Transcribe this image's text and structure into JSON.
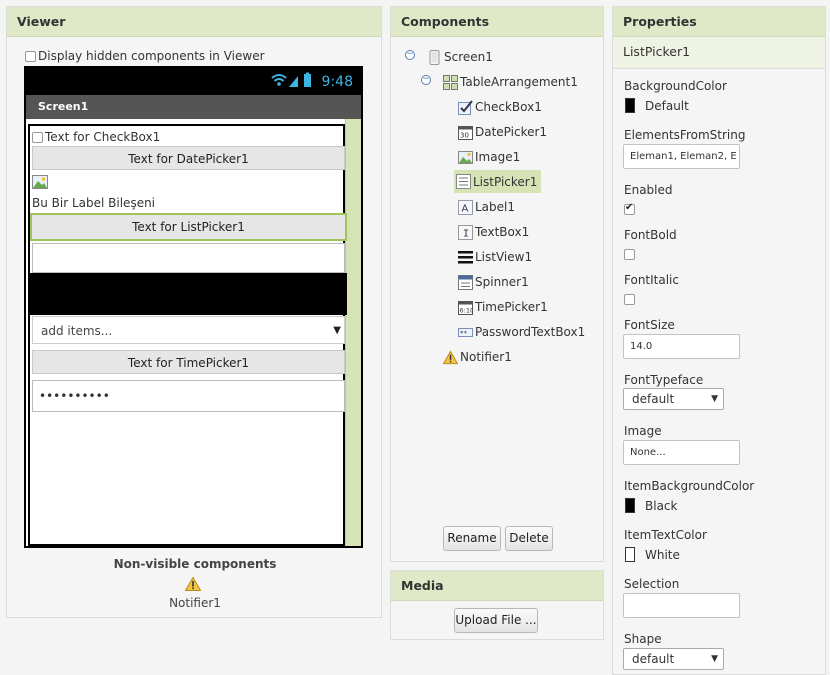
{
  "viewer": {
    "title": "Viewer",
    "hidden_components_label": "Display hidden components in Viewer",
    "phone": {
      "time": "9:48",
      "screen_title": "Screen1",
      "checkbox_text": "Text for CheckBox1",
      "datepicker_text": "Text for DatePicker1",
      "label_text": "Bu Bir Label Bileşeni",
      "listpicker_text": "Text for ListPicker1",
      "spinner_text": "add items...",
      "timepicker_text": "Text for TimePicker1",
      "password_value": "••••••••••"
    },
    "nonvisible_title": "Non-visible components",
    "nonvisible_item": "Notifier1"
  },
  "components": {
    "title": "Components",
    "items": [
      {
        "label": "Screen1",
        "icon": "screen-icon"
      },
      {
        "label": "TableArrangement1",
        "icon": "table-arrangement-icon"
      },
      {
        "label": "CheckBox1",
        "icon": "checkbox-icon"
      },
      {
        "label": "DatePicker1",
        "icon": "datepicker-icon"
      },
      {
        "label": "Image1",
        "icon": "image-icon"
      },
      {
        "label": "ListPicker1",
        "icon": "listpicker-icon"
      },
      {
        "label": "Label1",
        "icon": "label-icon"
      },
      {
        "label": "TextBox1",
        "icon": "textbox-icon"
      },
      {
        "label": "ListView1",
        "icon": "listview-icon"
      },
      {
        "label": "Spinner1",
        "icon": "spinner-icon"
      },
      {
        "label": "TimePicker1",
        "icon": "timepicker-icon"
      },
      {
        "label": "PasswordTextBox1",
        "icon": "password-icon"
      },
      {
        "label": "Notifier1",
        "icon": "warning-icon"
      }
    ],
    "rename_label": "Rename",
    "delete_label": "Delete"
  },
  "media": {
    "title": "Media",
    "upload_label": "Upload File ..."
  },
  "properties": {
    "title": "Properties",
    "component_name": "ListPicker1",
    "background_color_label": "BackgroundColor",
    "background_color_value": "Default",
    "elements_from_string_label": "ElementsFromString",
    "elements_from_string_value": "Eleman1, Eleman2, E",
    "enabled_label": "Enabled",
    "fontbold_label": "FontBold",
    "fontitalic_label": "FontItalic",
    "fontsize_label": "FontSize",
    "fontsize_value": "14.0",
    "fonttypeface_label": "FontTypeface",
    "fonttypeface_value": "default",
    "image_label": "Image",
    "image_value": "None...",
    "item_bg_color_label": "ItemBackgroundColor",
    "item_bg_color_value": "Black",
    "item_text_color_label": "ItemTextColor",
    "item_text_color_value": "White",
    "selection_label": "Selection",
    "selection_value": "",
    "shape_label": "Shape",
    "shape_value": "default"
  },
  "colors": {
    "header_bg": "#dfe9c8",
    "selection_bg": "#d6e3b5",
    "status_bar_accent": "#3cb5e5"
  }
}
